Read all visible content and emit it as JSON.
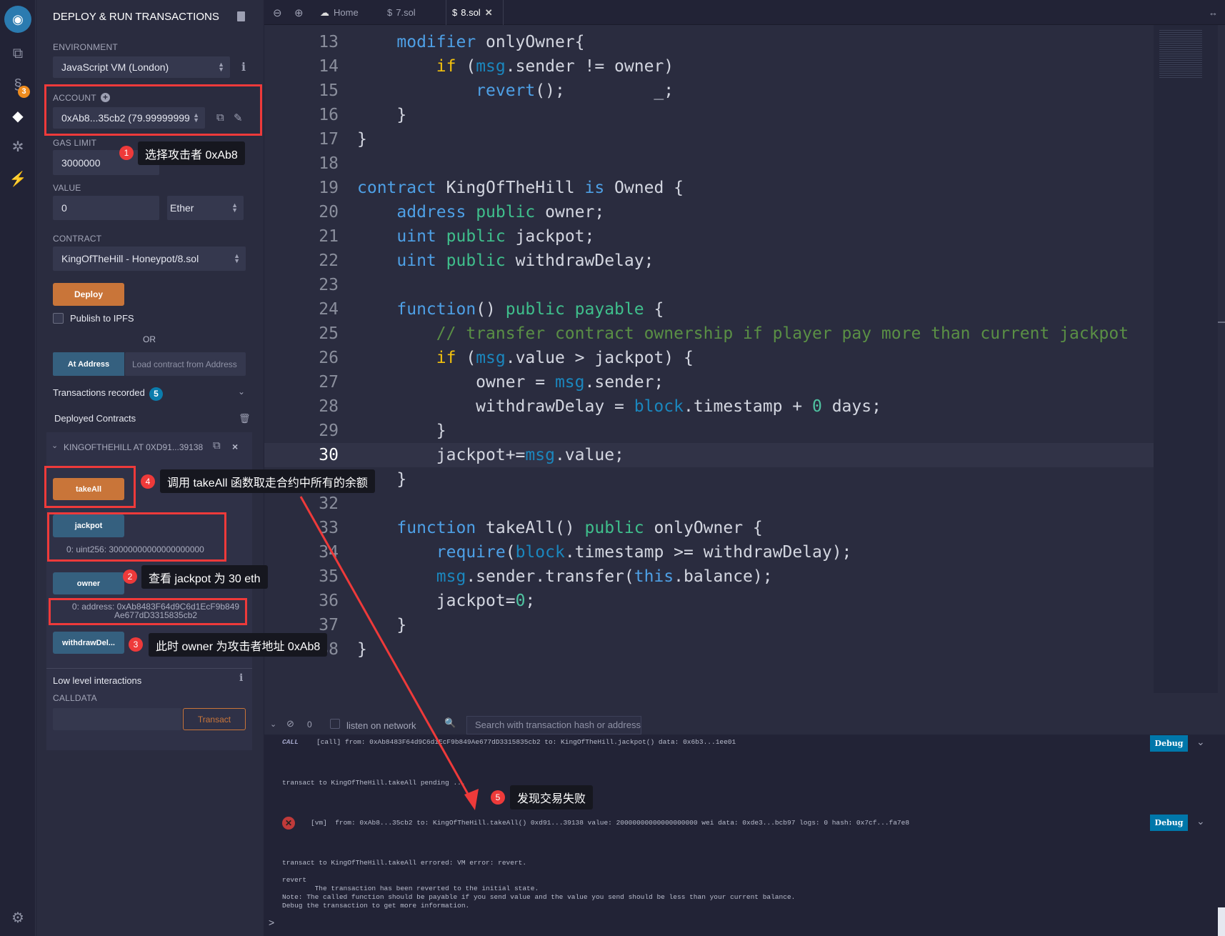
{
  "iconbar": {
    "items": [
      "remix-logo-icon",
      "file-explorer-icon",
      "solidity-compiler-icon",
      "deploy-run-icon",
      "debugger-icon",
      "plugin-manager-icon",
      "settings-icon"
    ],
    "compiler_badge": "3"
  },
  "panel": {
    "title": "DEPLOY & RUN TRANSACTIONS",
    "environment_label": "ENVIRONMENT",
    "environment_value": "JavaScript VM (London)",
    "account_label": "ACCOUNT",
    "account_value": "0xAb8...35cb2 (79.99999999",
    "gas_limit_label": "GAS LIMIT",
    "gas_limit_value": "3000000",
    "value_label": "VALUE",
    "value_value": "0",
    "value_unit": "Ether",
    "contract_label": "CONTRACT",
    "contract_value": "KingOfTheHill - Honeypot/8.sol",
    "deploy_label": "Deploy",
    "publish_label": "Publish to IPFS",
    "or_label": "OR",
    "at_address_label": "At Address",
    "load_contract_placeholder": "Load contract from Address",
    "transactions_recorded_label": "Transactions recorded",
    "transactions_recorded_count": "5",
    "deployed_contracts_label": "Deployed Contracts",
    "instance_title": "KINGOFTHEHILL AT 0XD91...39138",
    "functions": {
      "takeall": "takeAll",
      "jackpot": "jackpot",
      "owner": "owner",
      "withdraw": "withdrawDel..."
    },
    "jackpot_result": "0: uint256: 30000000000000000000",
    "owner_result_1": "0:  address: 0xAb8483F64d9C6d1EcF9b849",
    "owner_result_2": "Ae677dD3315835cb2",
    "low_level_label": "Low level interactions",
    "calldata_label": "CALLDATA",
    "transact_label": "Transact"
  },
  "editor": {
    "tabs": {
      "home": "Home",
      "tab7": "7.sol",
      "tab8": "8.sol"
    },
    "current_line": "30",
    "lines": [
      {
        "n": "13",
        "t": [
          [
            "    ",
            ""
          ],
          [
            "modifier",
            "kw"
          ],
          [
            " onlyOwner{",
            ""
          ]
        ]
      },
      {
        "n": "14",
        "t": [
          [
            "        ",
            ""
          ],
          [
            "if",
            "ifc"
          ],
          [
            " (",
            ""
          ],
          [
            "msg",
            "msg"
          ],
          [
            ".sender != owner)",
            ""
          ]
        ]
      },
      {
        "n": "15",
        "t": [
          [
            "            ",
            ""
          ],
          [
            "revert",
            "kw"
          ],
          [
            "();         _;",
            ""
          ]
        ]
      },
      {
        "n": "16",
        "t": [
          [
            "    }",
            ""
          ]
        ]
      },
      {
        "n": "17",
        "t": [
          [
            "}",
            ""
          ]
        ]
      },
      {
        "n": "18",
        "t": []
      },
      {
        "n": "19",
        "t": [
          [
            "contract",
            "kw"
          ],
          [
            " KingOfTheHill ",
            ""
          ],
          [
            "is",
            "kw"
          ],
          [
            " Owned {",
            ""
          ]
        ]
      },
      {
        "n": "20",
        "t": [
          [
            "    ",
            ""
          ],
          [
            "address",
            "kw"
          ],
          [
            " ",
            ""
          ],
          [
            "public",
            "pub"
          ],
          [
            " owner;",
            ""
          ]
        ]
      },
      {
        "n": "21",
        "t": [
          [
            "    ",
            ""
          ],
          [
            "uint",
            "kw"
          ],
          [
            " ",
            ""
          ],
          [
            "public",
            "pub"
          ],
          [
            " jackpot;",
            ""
          ]
        ]
      },
      {
        "n": "22",
        "t": [
          [
            "    ",
            ""
          ],
          [
            "uint",
            "kw"
          ],
          [
            " ",
            ""
          ],
          [
            "public",
            "pub"
          ],
          [
            " withdrawDelay;",
            ""
          ]
        ]
      },
      {
        "n": "23",
        "t": []
      },
      {
        "n": "24",
        "t": [
          [
            "    ",
            ""
          ],
          [
            "function",
            "kw"
          ],
          [
            "() ",
            ""
          ],
          [
            "public",
            "pub"
          ],
          [
            " ",
            ""
          ],
          [
            "payable",
            "pub"
          ],
          [
            " {",
            ""
          ]
        ]
      },
      {
        "n": "25",
        "t": [
          [
            "        ",
            ""
          ],
          [
            "// transfer contract ownership if player pay more than current jackpot",
            "cm"
          ]
        ]
      },
      {
        "n": "26",
        "t": [
          [
            "        ",
            ""
          ],
          [
            "if",
            "ifc"
          ],
          [
            " (",
            ""
          ],
          [
            "msg",
            "msg"
          ],
          [
            ".value > jackpot) {",
            ""
          ]
        ]
      },
      {
        "n": "27",
        "t": [
          [
            "            owner = ",
            ""
          ],
          [
            "msg",
            "msg"
          ],
          [
            ".sender;",
            ""
          ]
        ]
      },
      {
        "n": "28",
        "t": [
          [
            "            withdrawDelay = ",
            ""
          ],
          [
            "block",
            "msg"
          ],
          [
            ".timestamp + ",
            ""
          ],
          [
            "0",
            "num"
          ],
          [
            " days;",
            ""
          ]
        ]
      },
      {
        "n": "29",
        "t": [
          [
            "        }",
            ""
          ]
        ]
      },
      {
        "n": "30",
        "t": [
          [
            "        jackpot+=",
            ""
          ],
          [
            "msg",
            "msg"
          ],
          [
            ".value;",
            ""
          ]
        ]
      },
      {
        "n": "31",
        "t": [
          [
            "    }",
            ""
          ]
        ]
      },
      {
        "n": "32",
        "t": []
      },
      {
        "n": "33",
        "t": [
          [
            "    ",
            ""
          ],
          [
            "function",
            "kw"
          ],
          [
            " takeAll() ",
            ""
          ],
          [
            "public",
            "pub"
          ],
          [
            " onlyOwner {",
            ""
          ]
        ]
      },
      {
        "n": "34",
        "t": [
          [
            "        ",
            ""
          ],
          [
            "require",
            "kw"
          ],
          [
            "(",
            ""
          ],
          [
            "block",
            "msg"
          ],
          [
            ".timestamp >= withdrawDelay);",
            ""
          ]
        ]
      },
      {
        "n": "35",
        "t": [
          [
            "        ",
            ""
          ],
          [
            "msg",
            "msg"
          ],
          [
            ".sender.transfer(",
            ""
          ],
          [
            "this",
            "kw"
          ],
          [
            ".balance);",
            ""
          ]
        ]
      },
      {
        "n": "36",
        "t": [
          [
            "        jackpot=",
            ""
          ],
          [
            "0",
            "num"
          ],
          [
            ";",
            ""
          ]
        ]
      },
      {
        "n": "37",
        "t": [
          [
            "    }",
            ""
          ]
        ]
      },
      {
        "n": "38",
        "t": [
          [
            "}",
            ""
          ]
        ]
      }
    ]
  },
  "terminal": {
    "pending_count": "0",
    "listen_label": "listen on network",
    "search_placeholder": "Search with transaction hash or address",
    "call_tag": "CALL",
    "call_line": "[call] from: 0xAb8483F64d9C6d1EcF9b849Ae677dD3315835cb2 to: KingOfTheHill.jackpot() data: 0x6b3...1ee01",
    "pending_line": "transact to KingOfTheHill.takeAll pending ...",
    "vm_line": "[vm]  from: 0xAb8...35cb2 to: KingOfTheHill.takeAll() 0xd91...39138 value: 20000000000000000000 wei data: 0xde3...bcb97 logs: 0 hash: 0x7cf...fa7e8",
    "errored_line": "transact to KingOfTheHill.takeAll errored: VM error: revert.",
    "revert_block": "revert\n        The transaction has been reverted to the initial state.\nNote: The called function should be payable if you send value and the value you send should be less than your current balance.\nDebug the transaction to get more information.",
    "debug_label": "Debug",
    "prompt": ">"
  },
  "annotations": {
    "1": {
      "num": "1",
      "text": "选择攻击者 0xAb8"
    },
    "2": {
      "num": "2",
      "text": "查看 jackpot 为 30 eth"
    },
    "3": {
      "num": "3",
      "text": "此时 owner 为攻击者地址 0xAb8"
    },
    "4": {
      "num": "4",
      "text": "调用 takeAll 函数取走合约中所有的余额"
    },
    "5": {
      "num": "5",
      "text": "发现交易失败"
    },
    "color": "#ee3a3a"
  }
}
